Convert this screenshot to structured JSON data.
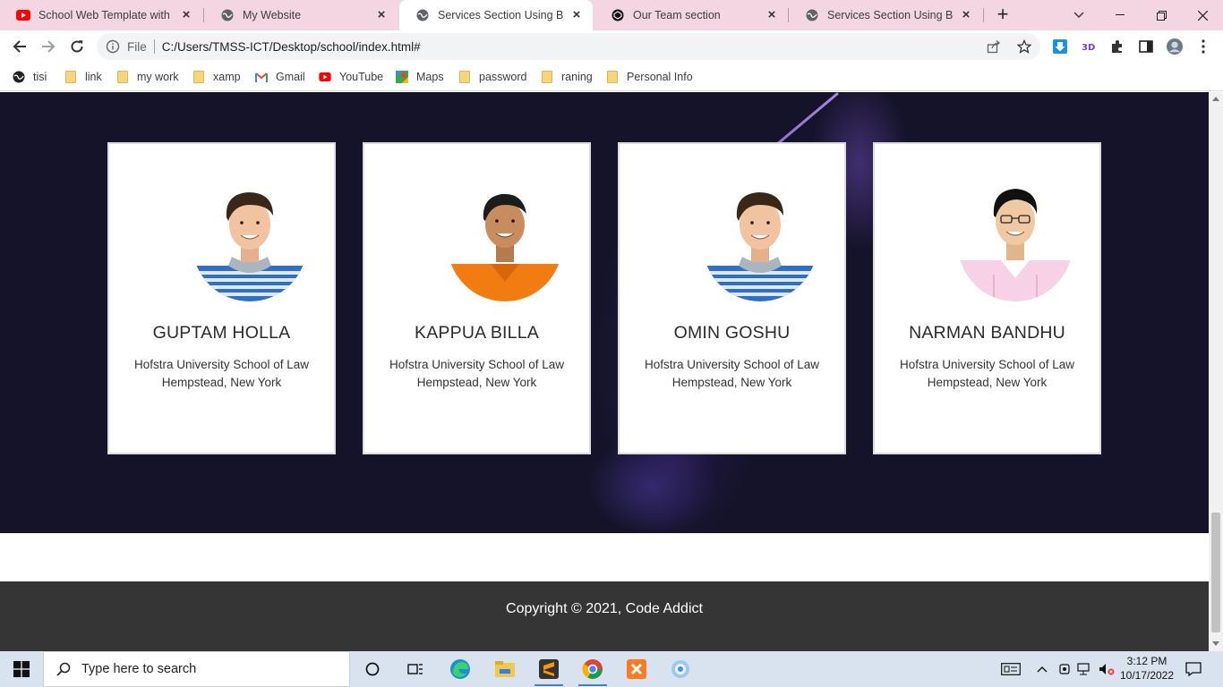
{
  "browser": {
    "tabs": [
      {
        "title": "School Web Template with H",
        "icon": "youtube-icon",
        "active": false
      },
      {
        "title": "My Website",
        "icon": "globe-icon",
        "active": false
      },
      {
        "title": "Services Section Using Boots",
        "icon": "globe-icon",
        "active": true
      },
      {
        "title": "Our Team section",
        "icon": "codepen-icon",
        "active": false
      },
      {
        "title": "Services Section Using Boots",
        "icon": "globe-icon",
        "active": false
      }
    ],
    "address": {
      "scheme": "File",
      "url": "C:/Users/TMSS-ICT/Desktop/school/index.html#"
    },
    "bookmarks": [
      {
        "label": "tisi",
        "icon": "globe-icon"
      },
      {
        "label": "link",
        "icon": "folder-icon"
      },
      {
        "label": "my work",
        "icon": "folder-icon"
      },
      {
        "label": "xamp",
        "icon": "folder-icon"
      },
      {
        "label": "Gmail",
        "icon": "gmail-icon"
      },
      {
        "label": "YouTube",
        "icon": "youtube-icon"
      },
      {
        "label": "Maps",
        "icon": "maps-icon"
      },
      {
        "label": "password",
        "icon": "folder-icon"
      },
      {
        "label": "raning",
        "icon": "folder-icon"
      },
      {
        "label": "Personal Info",
        "icon": "folder-icon"
      }
    ]
  },
  "team": {
    "members": [
      {
        "name": "GUPTAM HOLLA",
        "school": "Hofstra University School of Law",
        "city": "Hempstead, New York",
        "avatar": "avatar-striped-shirt"
      },
      {
        "name": "KAPPUA BILLA",
        "school": "Hofstra University School of Law",
        "city": "Hempstead, New York",
        "avatar": "avatar-orange-shirt"
      },
      {
        "name": "OMIN GOSHU",
        "school": "Hofstra University School of Law",
        "city": "Hempstead, New York",
        "avatar": "avatar-striped-shirt"
      },
      {
        "name": "NARMAN BANDHU",
        "school": "Hofstra University School of Law",
        "city": "Hempstead, New York",
        "avatar": "avatar-pink-shirt"
      }
    ]
  },
  "footer": {
    "copyright": "Copyright © 2021, Code Addict"
  },
  "taskbar": {
    "search_placeholder": "Type here to search",
    "time": "3:12 PM",
    "date": "10/17/2022"
  },
  "colors": {
    "section_bg": "#15132a",
    "footer_bg": "#353535",
    "tab_strip": "#f4d6e3"
  }
}
